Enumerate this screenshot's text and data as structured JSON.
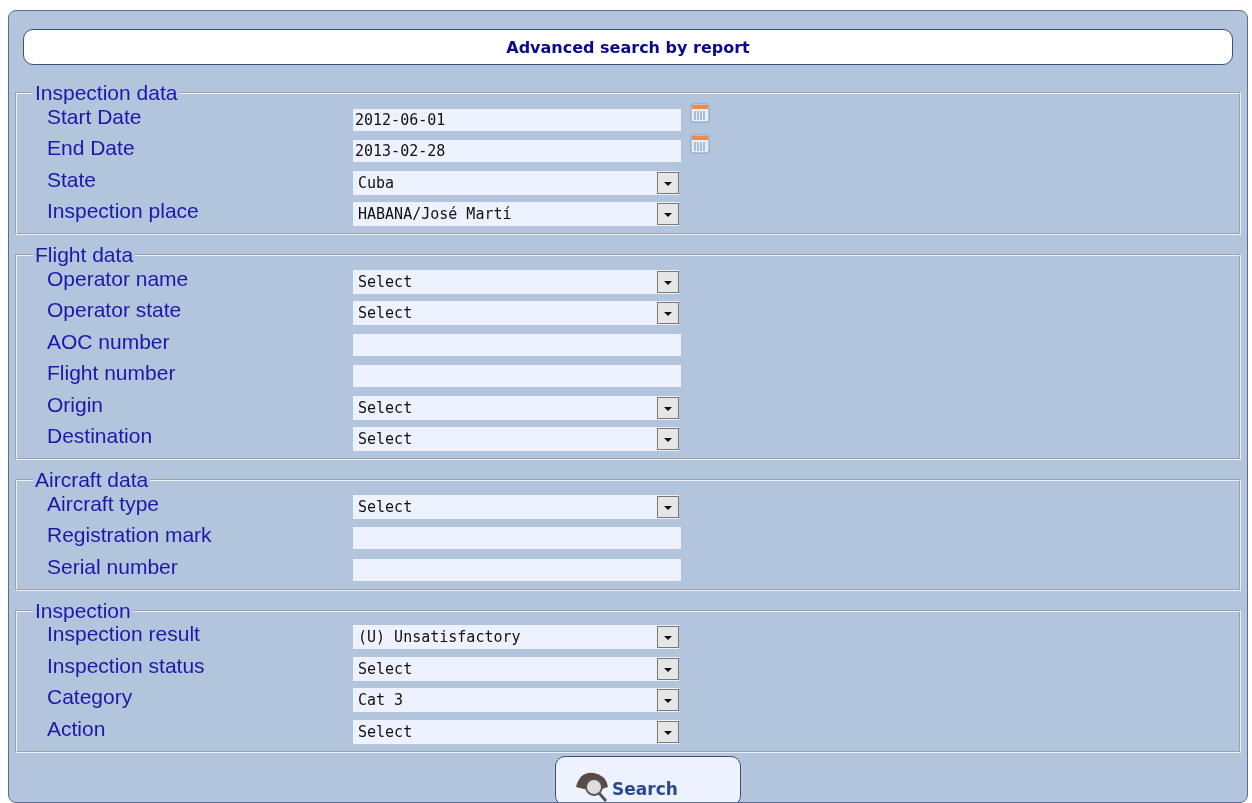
{
  "title": "Advanced search by report",
  "sections": [
    {
      "legend": "Inspection data",
      "fields": [
        {
          "label": "Start Date",
          "kind": "date",
          "value": "2012-06-01"
        },
        {
          "label": "End Date",
          "kind": "date",
          "value": "2013-02-28"
        },
        {
          "label": "State",
          "kind": "select",
          "value": "Cuba"
        },
        {
          "label": "Inspection place",
          "kind": "select",
          "value": "HABANA/José Martí"
        }
      ]
    },
    {
      "legend": "Flight data",
      "fields": [
        {
          "label": "Operator name",
          "kind": "select",
          "value": "Select"
        },
        {
          "label": "Operator state",
          "kind": "select",
          "value": "Select"
        },
        {
          "label": "AOC number",
          "kind": "text"
        },
        {
          "label": "Flight number",
          "kind": "text"
        },
        {
          "label": "Origin",
          "kind": "select",
          "value": "Select"
        },
        {
          "label": "Destination",
          "kind": "select",
          "value": "Select"
        }
      ]
    },
    {
      "legend": "Aircraft data",
      "fields": [
        {
          "label": "Aircraft type",
          "kind": "select",
          "value": "Select"
        },
        {
          "label": "Registration mark",
          "kind": "text"
        },
        {
          "label": "Serial number",
          "kind": "text"
        }
      ]
    },
    {
      "legend": "Inspection",
      "fields": [
        {
          "label": "Inspection result",
          "kind": "select",
          "value": "(U) Unsatisfactory"
        },
        {
          "label": "Inspection status",
          "kind": "select",
          "value": "Select"
        },
        {
          "label": "Category",
          "kind": "select",
          "value": "Cat 3"
        },
        {
          "label": "Action",
          "kind": "select",
          "value": "Select"
        }
      ]
    }
  ],
  "search_button": "Search"
}
